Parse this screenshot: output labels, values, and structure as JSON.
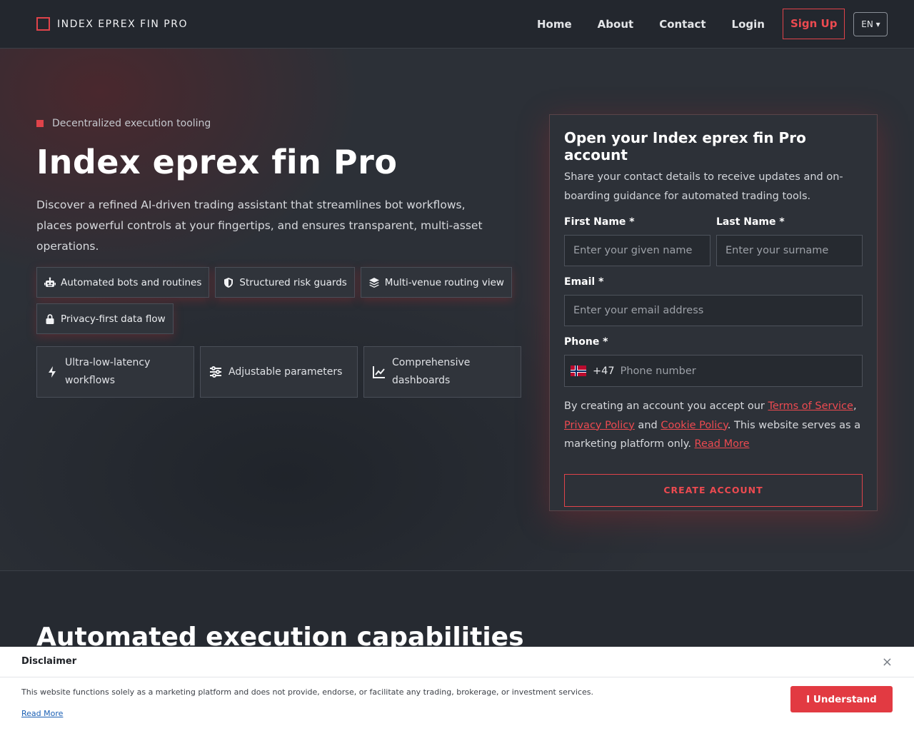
{
  "header": {
    "logo_text": "INDEX EPREX FIN PRO",
    "nav": {
      "home": "Home",
      "about": "About",
      "contact": "Contact",
      "login": "Login",
      "signup": "Sign Up"
    },
    "lang": "EN ▾"
  },
  "hero": {
    "eyebrow": "Decentralized execution tooling",
    "title": "Index eprex fin Pro",
    "description": "Discover a refined AI-driven trading assistant that streamlines bot workflows, places powerful controls at your fingertips, and ensures transparent, multi-asset operations.",
    "chips": [
      {
        "label": "Automated bots and routines",
        "icon": "robot-icon"
      },
      {
        "label": "Structured risk guards",
        "icon": "shield-icon"
      },
      {
        "label": "Multi-venue routing view",
        "icon": "layers-icon"
      },
      {
        "label": "Privacy-first data flow",
        "icon": "lock-icon"
      }
    ],
    "features": [
      {
        "label": "Ultra-low-latency workflows",
        "icon": "bolt-icon"
      },
      {
        "label": "Adjustable parameters",
        "icon": "sliders-icon"
      },
      {
        "label": "Comprehensive dashboards",
        "icon": "chart-line-icon"
      }
    ]
  },
  "form": {
    "title": "Open your Index eprex fin Pro account",
    "subtitle": "Share your contact details to receive updates and on-boarding guidance for automated trading tools.",
    "first_name_label": "First Name *",
    "first_name_placeholder": "Enter your given name",
    "last_name_label": "Last Name *",
    "last_name_placeholder": "Enter your surname",
    "email_label": "Email *",
    "email_placeholder": "Enter your email address",
    "phone_label": "Phone *",
    "dial_code": "+47",
    "phone_placeholder": "Phone number",
    "terms_prefix": "By creating an account you accept our ",
    "terms_link": "Terms of Service",
    "terms_comma": ", ",
    "privacy_link": "Privacy Policy",
    "terms_and": " and ",
    "cookie_link": "Cookie Policy",
    "terms_suffix": ". This website serves as a marketing platform only. ",
    "read_more": "Read More",
    "submit": "CREATE ACCOUNT"
  },
  "section": {
    "title": "Automated execution capabilities"
  },
  "disclaimer": {
    "title": "Disclaimer",
    "close": "×",
    "text": "This website functions solely as a marketing platform and does not provide, endorse, or facilitate any trading, brokerage, or investment services.",
    "read_more": "Read More",
    "button": "I Understand"
  },
  "colors": {
    "accent": "#e0434a",
    "background": "#262a31",
    "hero_background": "#2c3037"
  }
}
